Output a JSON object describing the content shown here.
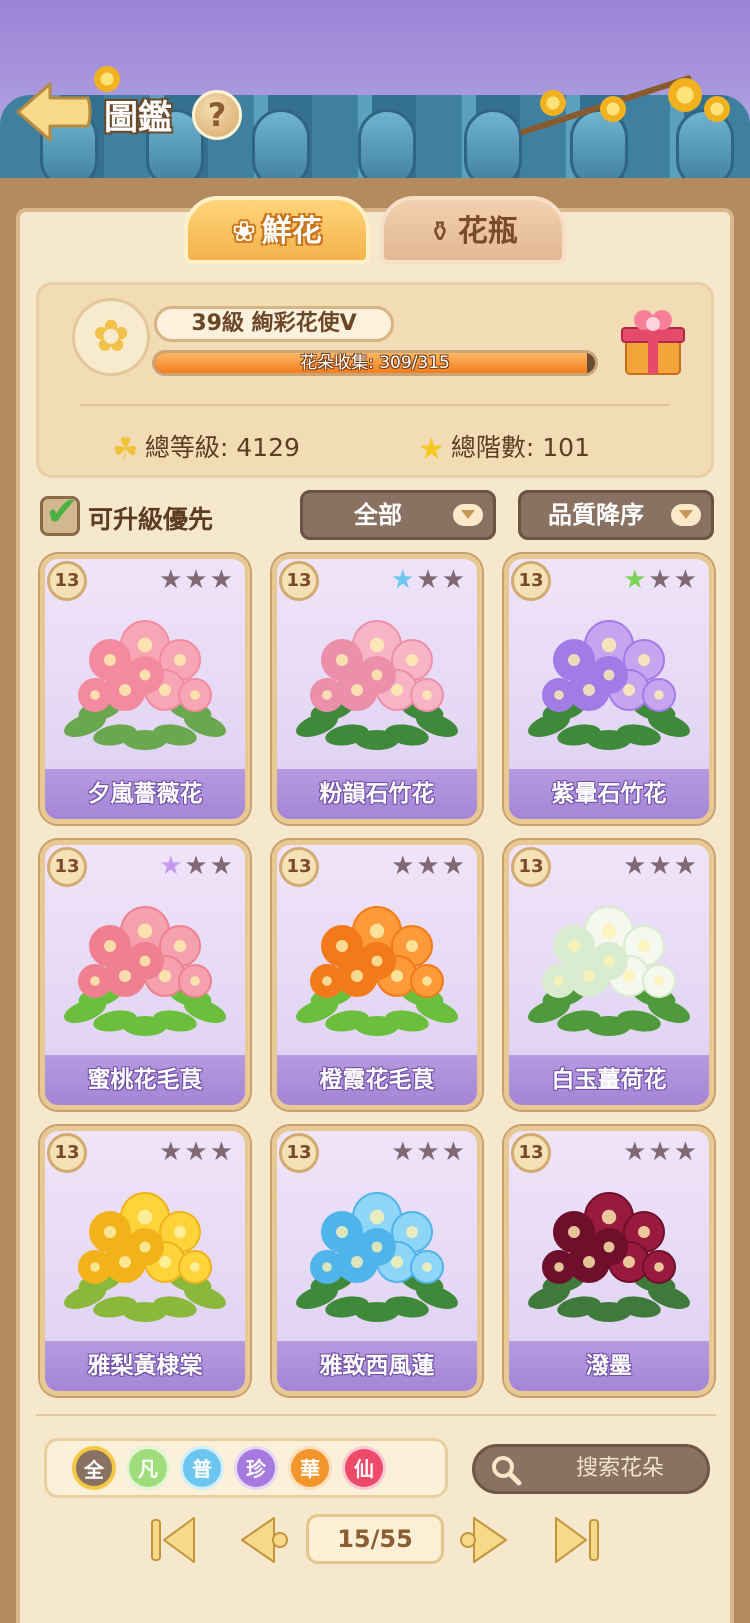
{
  "header": {
    "title": "圖鑑",
    "help_label": "?"
  },
  "tabs": [
    {
      "label": "鮮花",
      "icon": "rose-icon",
      "active": true
    },
    {
      "label": "花瓶",
      "icon": "vase-icon",
      "active": false
    }
  ],
  "profile": {
    "level_title": "39級  絢彩花使Ⅴ",
    "collection_text": "花朵收集: 309/315",
    "collection_current": 309,
    "collection_total": 315,
    "total_grade": "總等級: 4129",
    "total_stage": "總階數: 101"
  },
  "filters": {
    "upgrade_first_label": "可升級優先",
    "upgrade_first_checked": true,
    "category_value": "全部",
    "sort_value": "品質降序"
  },
  "flowers": [
    {
      "name": "夕嵐薔薇花",
      "level": "13",
      "stars": [
        "#7f6a73",
        "#7f6a73",
        "#7f6a73"
      ],
      "palette": [
        "#f7a6b5",
        "#f48aa0",
        "#6aa84f"
      ]
    },
    {
      "name": "粉韻石竹花",
      "level": "13",
      "stars": [
        "#6cc6f2",
        "#7f6a73",
        "#7f6a73"
      ],
      "palette": [
        "#f6b4c6",
        "#ec8fab",
        "#3f8a3a"
      ]
    },
    {
      "name": "紫暈石竹花",
      "level": "13",
      "stars": [
        "#7bd35b",
        "#7f6a73",
        "#7f6a73"
      ],
      "palette": [
        "#c6a4f0",
        "#a27ce6",
        "#3f8a3a"
      ]
    },
    {
      "name": "蜜桃花毛茛",
      "level": "13",
      "stars": [
        "#c49af0",
        "#7f6a73",
        "#7f6a73"
      ],
      "palette": [
        "#f6a2ae",
        "#ee8090",
        "#6bbf3c"
      ]
    },
    {
      "name": "橙霞花毛茛",
      "level": "13",
      "stars": [
        "#7f6a73",
        "#7f6a73",
        "#7f6a73"
      ],
      "palette": [
        "#ff9a3a",
        "#f27a1a",
        "#6bbf3c"
      ]
    },
    {
      "name": "白玉薑荷花",
      "level": "13",
      "stars": [
        "#7f6a73",
        "#7f6a73",
        "#7f6a73"
      ],
      "palette": [
        "#f4f8ee",
        "#d9eccf",
        "#4f9a3a"
      ]
    },
    {
      "name": "雅梨黃棣棠",
      "level": "13",
      "stars": [
        "#7f6a73",
        "#7f6a73",
        "#7f6a73"
      ],
      "palette": [
        "#ffd43a",
        "#f2b21a",
        "#8ab83a"
      ]
    },
    {
      "name": "雅致西風蓮",
      "level": "13",
      "stars": [
        "#7f6a73",
        "#7f6a73",
        "#7f6a73"
      ],
      "palette": [
        "#8ed6f8",
        "#4fb4ea",
        "#3f8a3a"
      ]
    },
    {
      "name": "潑墨",
      "level": "13",
      "stars": [
        "#7f6a73",
        "#7f6a73",
        "#7f6a73"
      ],
      "palette": [
        "#9a1a3f",
        "#6e0f2c",
        "#3f7a3a"
      ]
    }
  ],
  "quality_filters": [
    {
      "label": "全",
      "color": "#8a7262",
      "active": true
    },
    {
      "label": "凡",
      "color": "#9fdc7a",
      "active": false
    },
    {
      "label": "普",
      "color": "#6cc6f0",
      "active": false
    },
    {
      "label": "珍",
      "color": "#a77ae0",
      "active": false
    },
    {
      "label": "華",
      "color": "#f2952a",
      "active": false
    },
    {
      "label": "仙",
      "color": "#ee4a6a",
      "active": false
    }
  ],
  "search": {
    "placeholder": "搜索花朵"
  },
  "pagination": {
    "current": 15,
    "total": 55,
    "label": "15/55"
  }
}
